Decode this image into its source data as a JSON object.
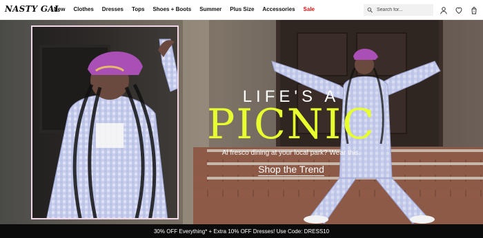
{
  "brand": {
    "logo_text": "NASTY GAL"
  },
  "nav": {
    "items": [
      {
        "label": "New"
      },
      {
        "label": "Clothes"
      },
      {
        "label": "Dresses"
      },
      {
        "label": "Tops"
      },
      {
        "label": "Shoes + Boots"
      },
      {
        "label": "Summer"
      },
      {
        "label": "Plus Size"
      },
      {
        "label": "Accessories"
      },
      {
        "label": "Sale"
      }
    ]
  },
  "search": {
    "placeholder": "Search for..."
  },
  "header_icons": {
    "account": "user-icon",
    "wishlist": "heart-icon",
    "bag": "bag-icon",
    "bag_count": "0"
  },
  "hero": {
    "headline_line1": "LIFE'S A",
    "headline_line2": "PICNIC",
    "subtext": "Al fresco dining at your local park? Wear this.",
    "cta": "Shop the Trend",
    "accent_color": "#E7FF2E",
    "inset_border_color": "#F2D8E8"
  },
  "promo": {
    "text": "30% OFF Everything* + Extra 10% OFF Dresses! Use Code: DRESS10"
  }
}
